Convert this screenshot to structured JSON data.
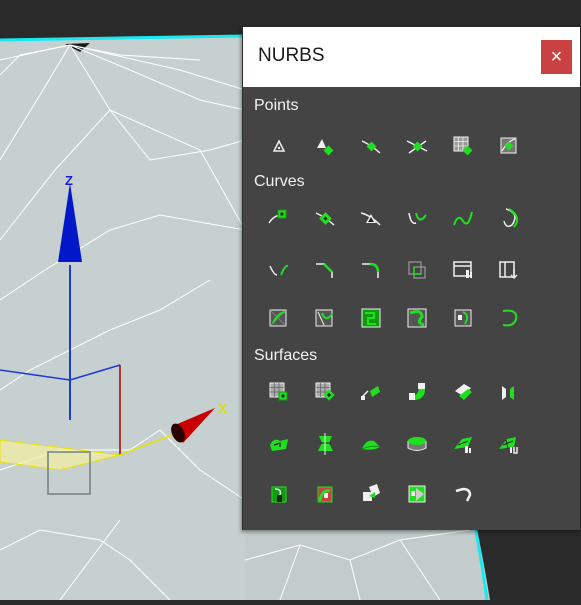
{
  "window": {
    "title": "NURBS",
    "close_glyph": "×"
  },
  "sections": [
    {
      "label": "Points",
      "rows": [
        [
          {
            "icon": "point-icon"
          },
          {
            "icon": "offset-point-icon"
          },
          {
            "icon": "curve-point-icon"
          },
          {
            "icon": "curve-curve-intersection-point-icon"
          },
          {
            "icon": "surface-point-icon"
          },
          {
            "icon": "surface-curve-point-icon"
          }
        ]
      ]
    },
    {
      "label": "Curves",
      "rows": [
        [
          {
            "icon": "cv-curve-icon"
          },
          {
            "icon": "point-curve-icon"
          },
          {
            "icon": "fit-curve-icon"
          },
          {
            "icon": "transform-curve-icon"
          },
          {
            "icon": "blend-curve-icon"
          },
          {
            "icon": "offset-curve-icon"
          }
        ],
        [
          {
            "icon": "mirror-curve-icon"
          },
          {
            "icon": "chamfer-curve-icon"
          },
          {
            "icon": "fillet-curve-icon"
          },
          {
            "icon": "surface-surface-intersection-curve-icon"
          },
          {
            "icon": "u-iso-curve-icon"
          },
          {
            "icon": "v-iso-curve-icon"
          }
        ],
        [
          {
            "icon": "normal-projected-curve-icon"
          },
          {
            "icon": "vector-projected-curve-icon"
          },
          {
            "icon": "cv-curve-on-surface-icon"
          },
          {
            "icon": "point-curve-on-surface-icon"
          },
          {
            "icon": "surface-offset-curve-icon"
          },
          {
            "icon": "surface-edge-curve-icon"
          }
        ]
      ]
    },
    {
      "label": "Surfaces",
      "rows": [
        [
          {
            "icon": "cv-surface-icon"
          },
          {
            "icon": "point-surface-icon"
          },
          {
            "icon": "transform-surface-icon"
          },
          {
            "icon": "blend-surface-icon"
          },
          {
            "icon": "offset-surface-icon"
          },
          {
            "icon": "mirror-surface-icon"
          }
        ],
        [
          {
            "icon": "extrude-surface-icon"
          },
          {
            "icon": "lathe-surface-icon"
          },
          {
            "icon": "ruled-surface-icon"
          },
          {
            "icon": "cap-surface-icon"
          },
          {
            "icon": "u-loft-surface-icon"
          },
          {
            "icon": "uv-loft-surface-icon"
          }
        ],
        [
          {
            "icon": "one-rail-sweep-icon"
          },
          {
            "icon": "two-rail-sweep-icon"
          },
          {
            "icon": "multisided-blend-icon"
          },
          {
            "icon": "multicurve-trimmed-surface-icon"
          },
          {
            "icon": "fillet-surface-icon"
          }
        ]
      ]
    }
  ],
  "viewport": {
    "gizmo_labels": {
      "z": "Z",
      "x": "X"
    },
    "colors": {
      "mesh_fill": "#c9d3d3",
      "wire": "#ffffff",
      "selection_edge": "#19e8f0",
      "z_axis": "#0018c8",
      "x_axis": "#c80000",
      "plane": "#e8e000"
    }
  },
  "theme": {
    "panel_bg": "#444444",
    "icon_green": "#1fe01f",
    "icon_white": "#f0f0f0",
    "close_bg": "#c94141"
  }
}
